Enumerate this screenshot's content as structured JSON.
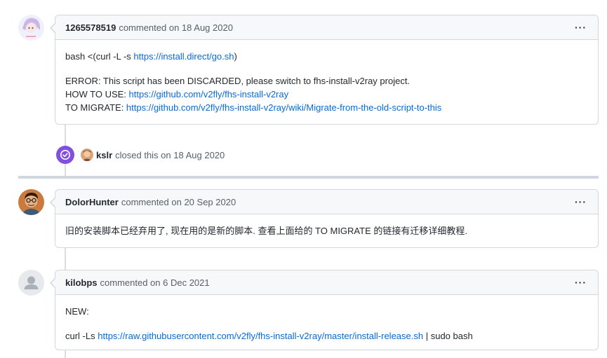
{
  "comments": [
    {
      "author": "1265578519",
      "meta": "commented on 18 Aug 2020",
      "menu": "···",
      "line1_prefix": "bash <(curl -L -s ",
      "line1_link": "https://install.direct/go.sh",
      "line1_suffix": ")",
      "error_line": "ERROR: This script has been DISCARDED, please switch to fhs-install-v2ray project.",
      "howto_prefix": "HOW TO USE: ",
      "howto_link": "https://github.com/v2fly/fhs-install-v2ray",
      "migrate_prefix": "TO MIGRATE: ",
      "migrate_link": "https://github.com/v2fly/fhs-install-v2ray/wiki/Migrate-from-the-old-script-to-this"
    },
    {
      "author": "DolorHunter",
      "meta": "commented on 20 Sep 2020",
      "menu": "···",
      "text": "旧的安装脚本已经弃用了, 现在用的是新的脚本. 查看上面给的 TO MIGRATE 的链接有迁移详细教程."
    },
    {
      "author": "kilobps",
      "meta": "commented on 6 Dec 2021",
      "menu": "···",
      "line1": "NEW:",
      "cmd_prefix": "curl -Ls ",
      "cmd_link": "https://raw.githubusercontent.com/v2fly/fhs-install-v2ray/master/install-release.sh",
      "cmd_suffix": " | sudo bash"
    }
  ],
  "event": {
    "icon": "check-circle-icon",
    "author": "kslr",
    "text": "closed this on 18 Aug 2020"
  },
  "colors": {
    "link": "#0969da",
    "closed_badge": "#8250df",
    "border": "#d0d7de",
    "header_bg": "#f6f8fa"
  }
}
